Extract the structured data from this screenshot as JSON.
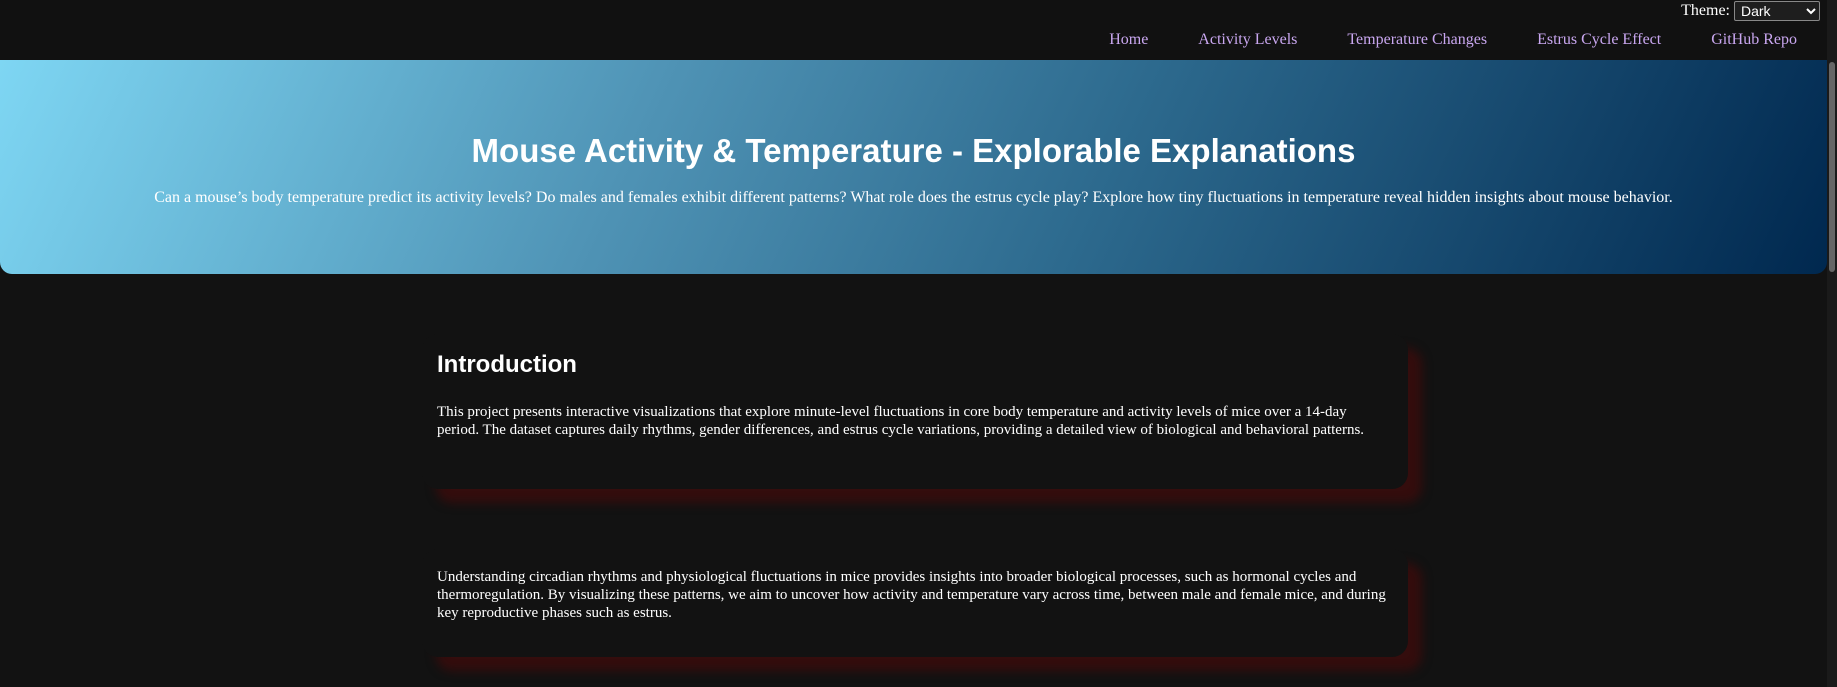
{
  "theme": {
    "label": "Theme:",
    "selected": "Dark"
  },
  "nav": [
    {
      "label": "Home"
    },
    {
      "label": "Activity Levels"
    },
    {
      "label": "Temperature Changes"
    },
    {
      "label": "Estrus Cycle Effect"
    },
    {
      "label": "GitHub Repo"
    }
  ],
  "hero": {
    "title": "Mouse Activity & Temperature - Explorable Explanations",
    "subtitle": "Can a mouse’s body temperature predict its activity levels? Do males and females exhibit different patterns? What role does the estrus cycle play? Explore how tiny fluctuations in temperature reveal hidden insights about mouse behavior."
  },
  "intro": {
    "heading": "Introduction",
    "text": "This project presents interactive visualizations that explore minute-level fluctuations in core body temperature and activity levels of mice over a 14-day period. The dataset captures daily rhythms, gender differences, and estrus cycle variations, providing a detailed view of biological and behavioral patterns."
  },
  "section2": {
    "text": "Understanding circadian rhythms and physiological fluctuations in mice provides insights into broader biological processes, such as hormonal cycles and thermoregulation. By visualizing these patterns, we aim to uncover how activity and temperature vary across time, between male and female mice, and during key reproductive phases such as estrus."
  },
  "colors": {
    "nav_link": "#c9a7f0",
    "background": "#121212",
    "card_shadow": "#500a0a"
  }
}
